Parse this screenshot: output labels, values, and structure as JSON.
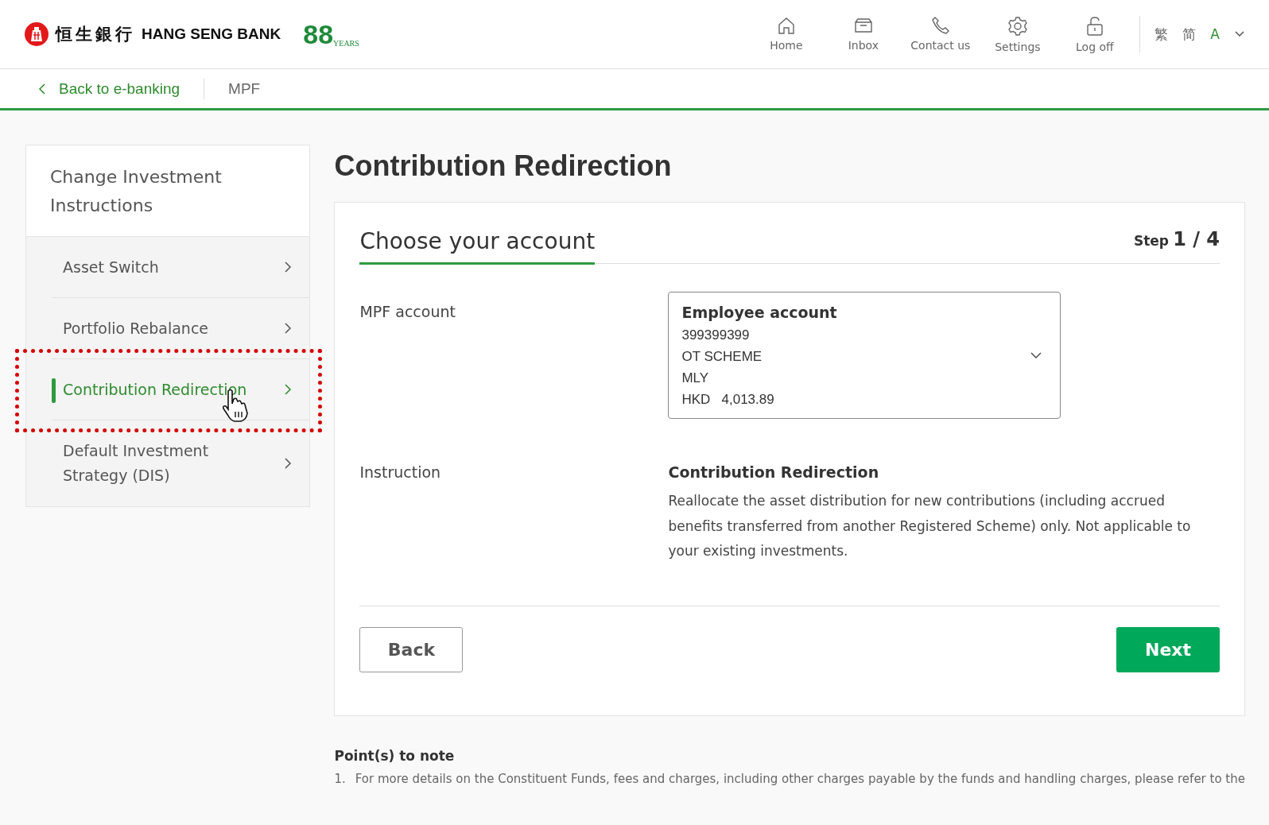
{
  "header": {
    "logo_chinese": "恒生銀行",
    "logo_text": "HANG SENG BANK",
    "anniversary_number": "88",
    "anniversary_text": "YEARS",
    "nav": [
      {
        "label": "Home",
        "kind": "home"
      },
      {
        "label": "Inbox",
        "kind": "inbox"
      },
      {
        "label": "Contact us",
        "kind": "phone"
      },
      {
        "label": "Settings",
        "kind": "settings"
      },
      {
        "label": "Log off",
        "kind": "lock"
      }
    ],
    "languages": [
      {
        "label": "繁",
        "selected": false
      },
      {
        "label": "简",
        "selected": false
      },
      {
        "label": "A",
        "selected": true
      }
    ]
  },
  "breadcrumb": {
    "back": "Back to e-banking",
    "current": "MPF"
  },
  "sidebar": {
    "title": "Change Investment Instructions",
    "items": [
      {
        "label": "Asset Switch",
        "selected": false,
        "highlighted": false
      },
      {
        "label": "Portfolio Rebalance",
        "selected": false,
        "highlighted": false
      },
      {
        "label": "Contribution Redirection",
        "selected": true,
        "highlighted": true
      },
      {
        "label": "Default Investment Strategy (DIS)",
        "selected": false,
        "highlighted": false
      }
    ]
  },
  "page_title": "Contribution Redirection",
  "card": {
    "section_title": "Choose your account",
    "step_label": "Step",
    "step_value": "1 / 4",
    "account_label": "MPF account",
    "account": {
      "type": "Employee account",
      "number": "399399399",
      "scheme": "OT SCHEME",
      "plan": "MLY",
      "currency": "HKD",
      "balance": "4,013.89"
    },
    "instruction_label": "Instruction",
    "instruction_title": "Contribution Redirection",
    "instruction_text": "Reallocate the asset distribution for new contributions (including accrued benefits transferred from another Registered Scheme) only. Not applicable to your existing investments.",
    "back_button": "Back",
    "next_button": "Next"
  },
  "notes": {
    "title": "Point(s) to note",
    "items": [
      {
        "number": "1.",
        "text": "For more details on the Constituent Funds, fees and charges, including other charges payable by the funds and handling charges, please refer to the"
      }
    ]
  }
}
